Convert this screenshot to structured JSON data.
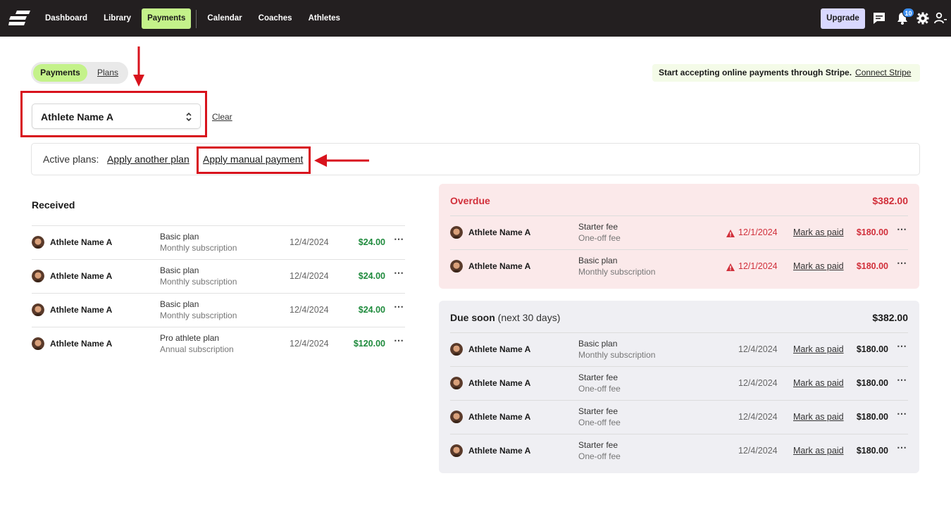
{
  "nav": {
    "items": [
      "Dashboard",
      "Library",
      "Payments",
      "Calendar",
      "Coaches",
      "Athletes"
    ],
    "active": "Payments",
    "upgrade_label": "Upgrade",
    "notification_count": "10"
  },
  "toggle": {
    "active_label": "Payments",
    "other_label": "Plans"
  },
  "stripe": {
    "text": "Start accepting online payments through Stripe.",
    "link": "Connect Stripe"
  },
  "filter": {
    "selected": "Athlete Name A",
    "clear_label": "Clear"
  },
  "active_plans": {
    "label": "Active plans:",
    "apply_plan": "Apply another plan",
    "apply_manual": "Apply manual payment"
  },
  "received": {
    "title": "Received",
    "rows": [
      {
        "name": "Athlete Name A",
        "plan": "Basic plan",
        "type": "Monthly subscription",
        "date": "12/4/2024",
        "amount": "$24.00"
      },
      {
        "name": "Athlete Name A",
        "plan": "Basic plan",
        "type": "Monthly subscription",
        "date": "12/4/2024",
        "amount": "$24.00"
      },
      {
        "name": "Athlete Name A",
        "plan": "Basic plan",
        "type": "Monthly subscription",
        "date": "12/4/2024",
        "amount": "$24.00"
      },
      {
        "name": "Athlete Name A",
        "plan": "Pro athlete plan",
        "type": "Annual subscription",
        "date": "12/4/2024",
        "amount": "$120.00"
      }
    ]
  },
  "overdue": {
    "title": "Overdue",
    "total": "$382.00",
    "mark_label": "Mark as paid",
    "rows": [
      {
        "name": "Athlete Name A",
        "plan": "Starter fee",
        "type": "One-off fee",
        "date": "12/1/2024",
        "amount": "$180.00"
      },
      {
        "name": "Athlete Name A",
        "plan": "Basic plan",
        "type": "Monthly subscription",
        "date": "12/1/2024",
        "amount": "$180.00"
      }
    ]
  },
  "due_soon": {
    "title": "Due soon",
    "subtitle": "(next 30 days)",
    "total": "$382.00",
    "mark_label": "Mark as paid",
    "rows": [
      {
        "name": "Athlete Name A",
        "plan": "Basic plan",
        "type": "Monthly subscription",
        "date": "12/4/2024",
        "amount": "$180.00"
      },
      {
        "name": "Athlete Name A",
        "plan": "Starter fee",
        "type": "One-off fee",
        "date": "12/4/2024",
        "amount": "$180.00"
      },
      {
        "name": "Athlete Name A",
        "plan": "Starter fee",
        "type": "One-off fee",
        "date": "12/4/2024",
        "amount": "$180.00"
      },
      {
        "name": "Athlete Name A",
        "plan": "Starter fee",
        "type": "One-off fee",
        "date": "12/4/2024",
        "amount": "$180.00"
      }
    ]
  },
  "colors": {
    "accent": "#c4f28a",
    "overdue_red": "#d12f3a",
    "received_green": "#1e8a3c",
    "annotation_red": "#d8131d"
  }
}
